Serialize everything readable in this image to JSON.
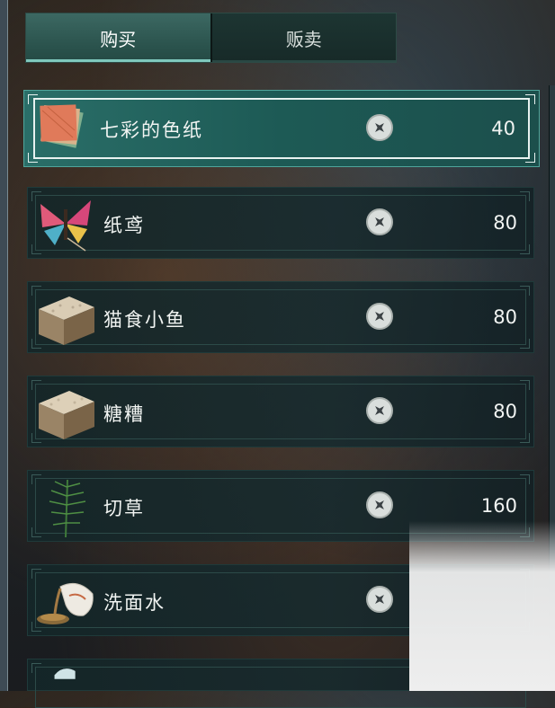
{
  "tabs": [
    {
      "label": "购买",
      "active": true
    },
    {
      "label": "贩卖",
      "active": false
    }
  ],
  "items": [
    {
      "name": "七彩的色纸",
      "price": "40",
      "icon": "colored-paper-icon",
      "selected": true
    },
    {
      "name": "纸鸢",
      "price": "80",
      "icon": "butterfly-kite-icon",
      "selected": false
    },
    {
      "name": "猫食小鱼",
      "price": "80",
      "icon": "food-crate-icon",
      "selected": false
    },
    {
      "name": "糖糟",
      "price": "80",
      "icon": "food-crate-icon",
      "selected": false
    },
    {
      "name": "切草",
      "price": "160",
      "icon": "grass-sprig-icon",
      "selected": false
    },
    {
      "name": "洗面水",
      "price": "",
      "icon": "pouring-vase-icon",
      "selected": false
    }
  ],
  "currency_icon": "coin-icon",
  "colors": {
    "accent": "#2a6e68",
    "selected_border": "#e8f2f0",
    "text": "#f1f4f2"
  }
}
